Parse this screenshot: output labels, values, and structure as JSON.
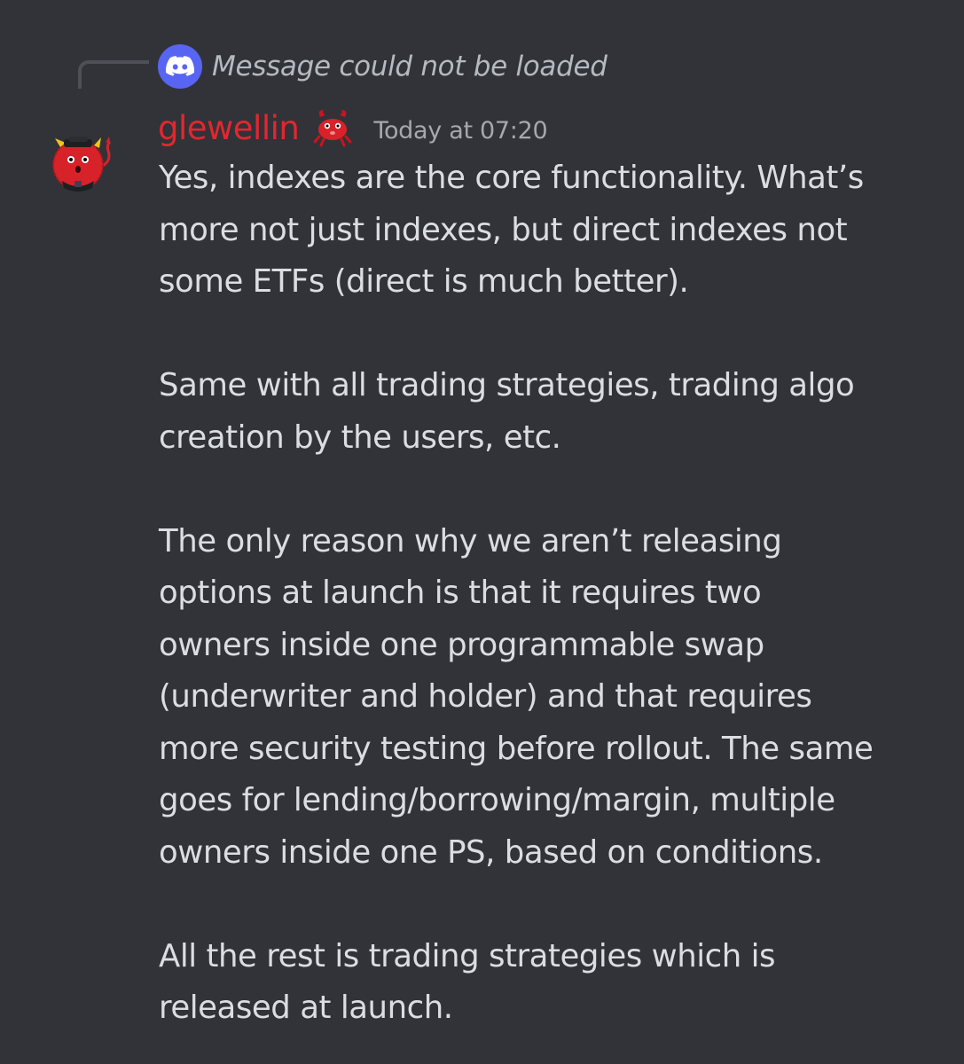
{
  "reply": {
    "icon": "discord-logo-icon",
    "text": "Message could not be loaded"
  },
  "message": {
    "author": "glewellin",
    "author_color": "#e3262f",
    "badge_icon": "red-crab-emoji-icon",
    "timestamp": "Today at 07:20",
    "paragraphs": [
      "Yes, indexes are the core functionality. What’s\nmore not just indexes, but direct indexes not\nsome ETFs (direct is much better).",
      "Same with all trading strategies, trading algo\ncreation by the users, etc.",
      "The only reason why we aren’t releasing\noptions at launch is that it requires two\nowners inside one programmable swap\n(underwriter and holder) and that requires\nmore security testing before rollout. The same\ngoes for lending/borrowing/margin, multiple\nowners inside one PS, based on conditions.",
      "All the rest is trading strategies which is\nreleased at launch."
    ]
  },
  "colors": {
    "background": "#313338",
    "text": "#dbdee1",
    "muted": "#b5bac1",
    "discord_blurple": "#5865f2"
  }
}
